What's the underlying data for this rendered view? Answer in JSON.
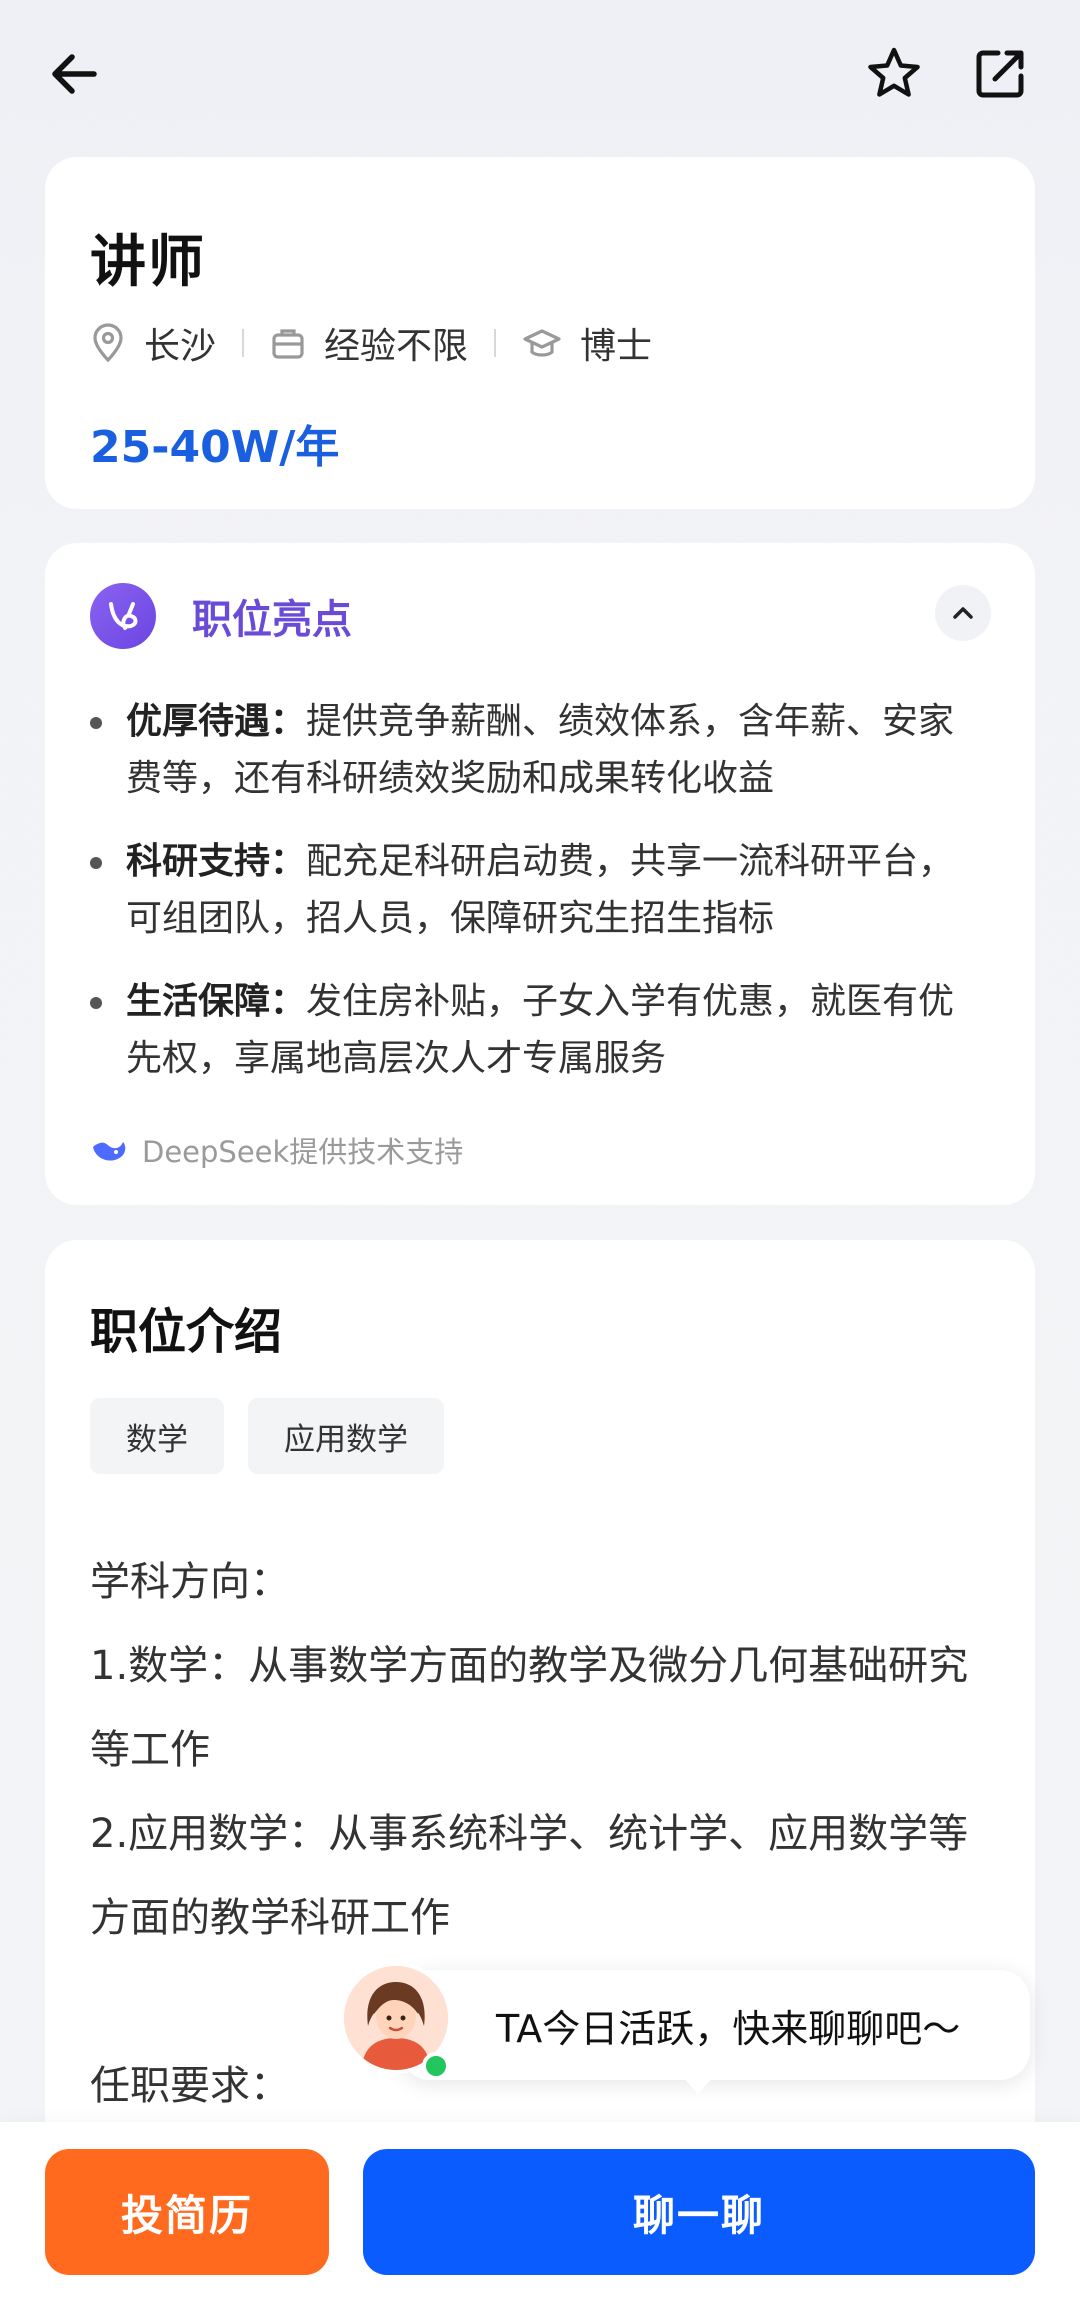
{
  "header": {
    "job_title": "讲师",
    "location": "长沙",
    "experience": "经验不限",
    "education": "博士",
    "salary": "25-40W/年"
  },
  "highlights": {
    "title": "职位亮点",
    "items": [
      {
        "label": "优厚待遇：",
        "text": "提供竞争薪酬、绩效体系，含年薪、安家费等，还有科研绩效奖励和成果转化收益"
      },
      {
        "label": "科研支持：",
        "text": "配充足科研启动费，共享一流科研平台，可组团队，招人员，保障研究生招生指标"
      },
      {
        "label": "生活保障：",
        "text": "发住房补贴，子女入学有优惠，就医有优先权，享属地高层次人才专属服务"
      }
    ],
    "powered_by": "DeepSeek提供技术支持"
  },
  "intro": {
    "title": "职位介绍",
    "tags": [
      "数学",
      "应用数学"
    ],
    "lines": [
      "学科方向：",
      "1.数学：从事数学方面的教学及微分几何基础研究等工作",
      "2.应用数学：从事系统科学、统计学、应用数学等方面的教学科研工作",
      "任职要求："
    ]
  },
  "chat_bubble": {
    "text": "TA今日活跃，快来聊聊吧～"
  },
  "actions": {
    "resume_label": "投简历",
    "chat_label": "聊一聊"
  },
  "colors": {
    "salary": "#1a5fe0",
    "highlight_title": "#6a4bd8",
    "resume_button": "#ff6a1e",
    "chat_button": "#0b5cff",
    "online": "#22c55e"
  },
  "icons": {
    "back": "arrow-left-icon",
    "favorite": "star-icon",
    "share": "share-icon",
    "location": "location-pin-icon",
    "experience": "briefcase-icon",
    "education": "graduation-cap-icon",
    "highlight": "ai-logo-icon",
    "collapse": "chevron-up-icon",
    "deepseek": "deepseek-whale-icon"
  }
}
